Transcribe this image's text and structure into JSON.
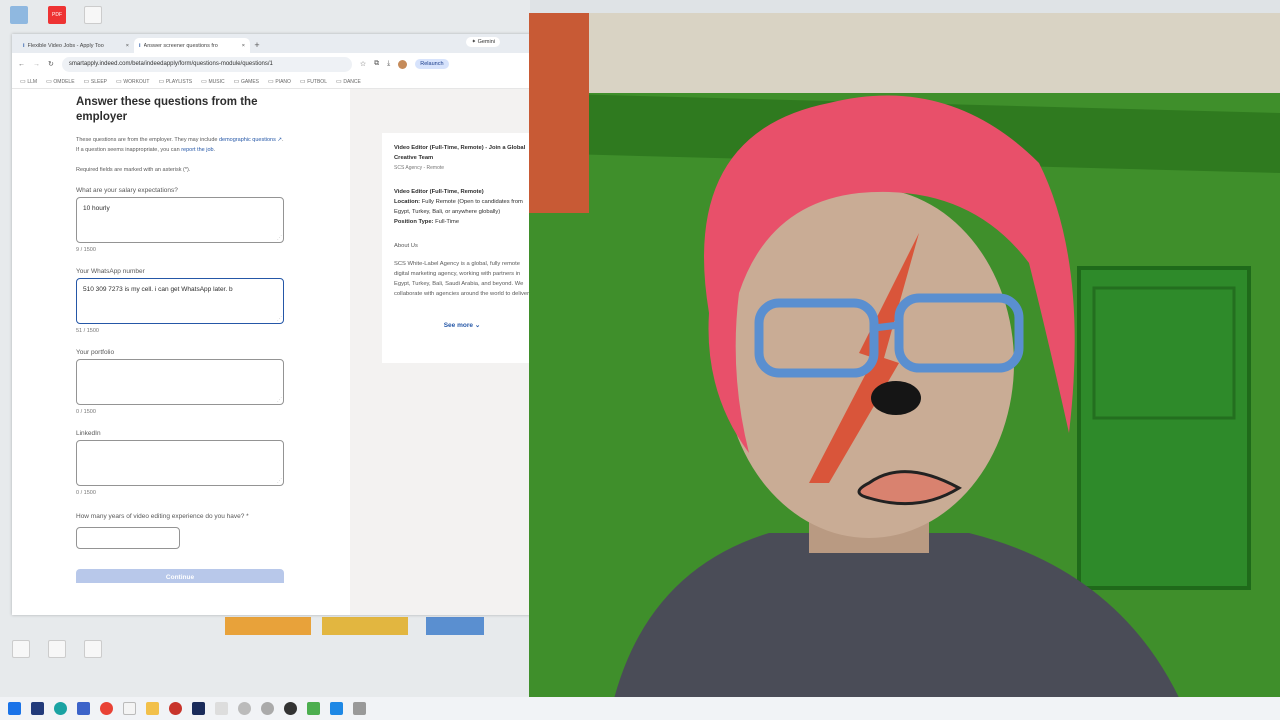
{
  "browser": {
    "tabs": [
      {
        "title": "Flexible Video Jobs - Apply Too",
        "active": false
      },
      {
        "title": "Answer screener questions fro",
        "active": true
      }
    ],
    "gemini_label": "Gemini",
    "url": "smartapply.indeed.com/beta/indeedapply/form/questions-module/questions/1",
    "relaunch_label": "Relaunch",
    "bookmarks": [
      "LLM",
      "OMDELE",
      "SLEEP",
      "WORKOUT",
      "PLAYLISTS",
      "MUSIC",
      "GAMES",
      "PIANO",
      "FUTBOL",
      "DANCE"
    ]
  },
  "form": {
    "title": "Answer these questions from the employer",
    "intro_1": "These questions are from the employer. They may include",
    "intro_link": "demographic questions",
    "intro_2": ". If a question seems inappropriate,",
    "intro_3": "you can",
    "intro_report": "report the job",
    "required_note": "Required fields are marked with an asterisk (*).",
    "questions": [
      {
        "label": "What are your salary expectations?",
        "value": "10 hourly",
        "count": "9 / 1500"
      },
      {
        "label": "Your WhatsApp number",
        "value": "510 309 7273 is my cell. i can get WhatsApp later. b",
        "count": "51 / 1500"
      },
      {
        "label": "Your portfolio",
        "value": "",
        "count": "0 / 1500"
      },
      {
        "label": "LinkedIn",
        "value": "",
        "count": "0 / 1500"
      }
    ],
    "years_label": "How many years of video editing experience do you have? *",
    "continue_label": "Continue"
  },
  "job_card": {
    "title": "Video Editor (Full-Time, Remote) - Join a Global Creative Team",
    "company": "SCS Agency - Remote",
    "heading": "Video Editor (Full-Time, Remote)",
    "location_label": "Location:",
    "location_value": "Fully Remote (Open to candidates from Egypt, Turkey, Bali, or anywhere globally)",
    "position_label": "Position Type:",
    "position_value": "Full-Time",
    "about_heading": "About Us",
    "about_text": "SCS White-Label Agency is a global, fully remote digital marketing agency, working with partners in Egypt, Turkey, Bali, Saudi Arabia, and beyond. We collaborate with agencies around the world to deliver",
    "see_more": "See more"
  },
  "colors": {
    "accent": "#2557a7",
    "hair": "#e8506a",
    "wall": "#3d8a2a"
  }
}
